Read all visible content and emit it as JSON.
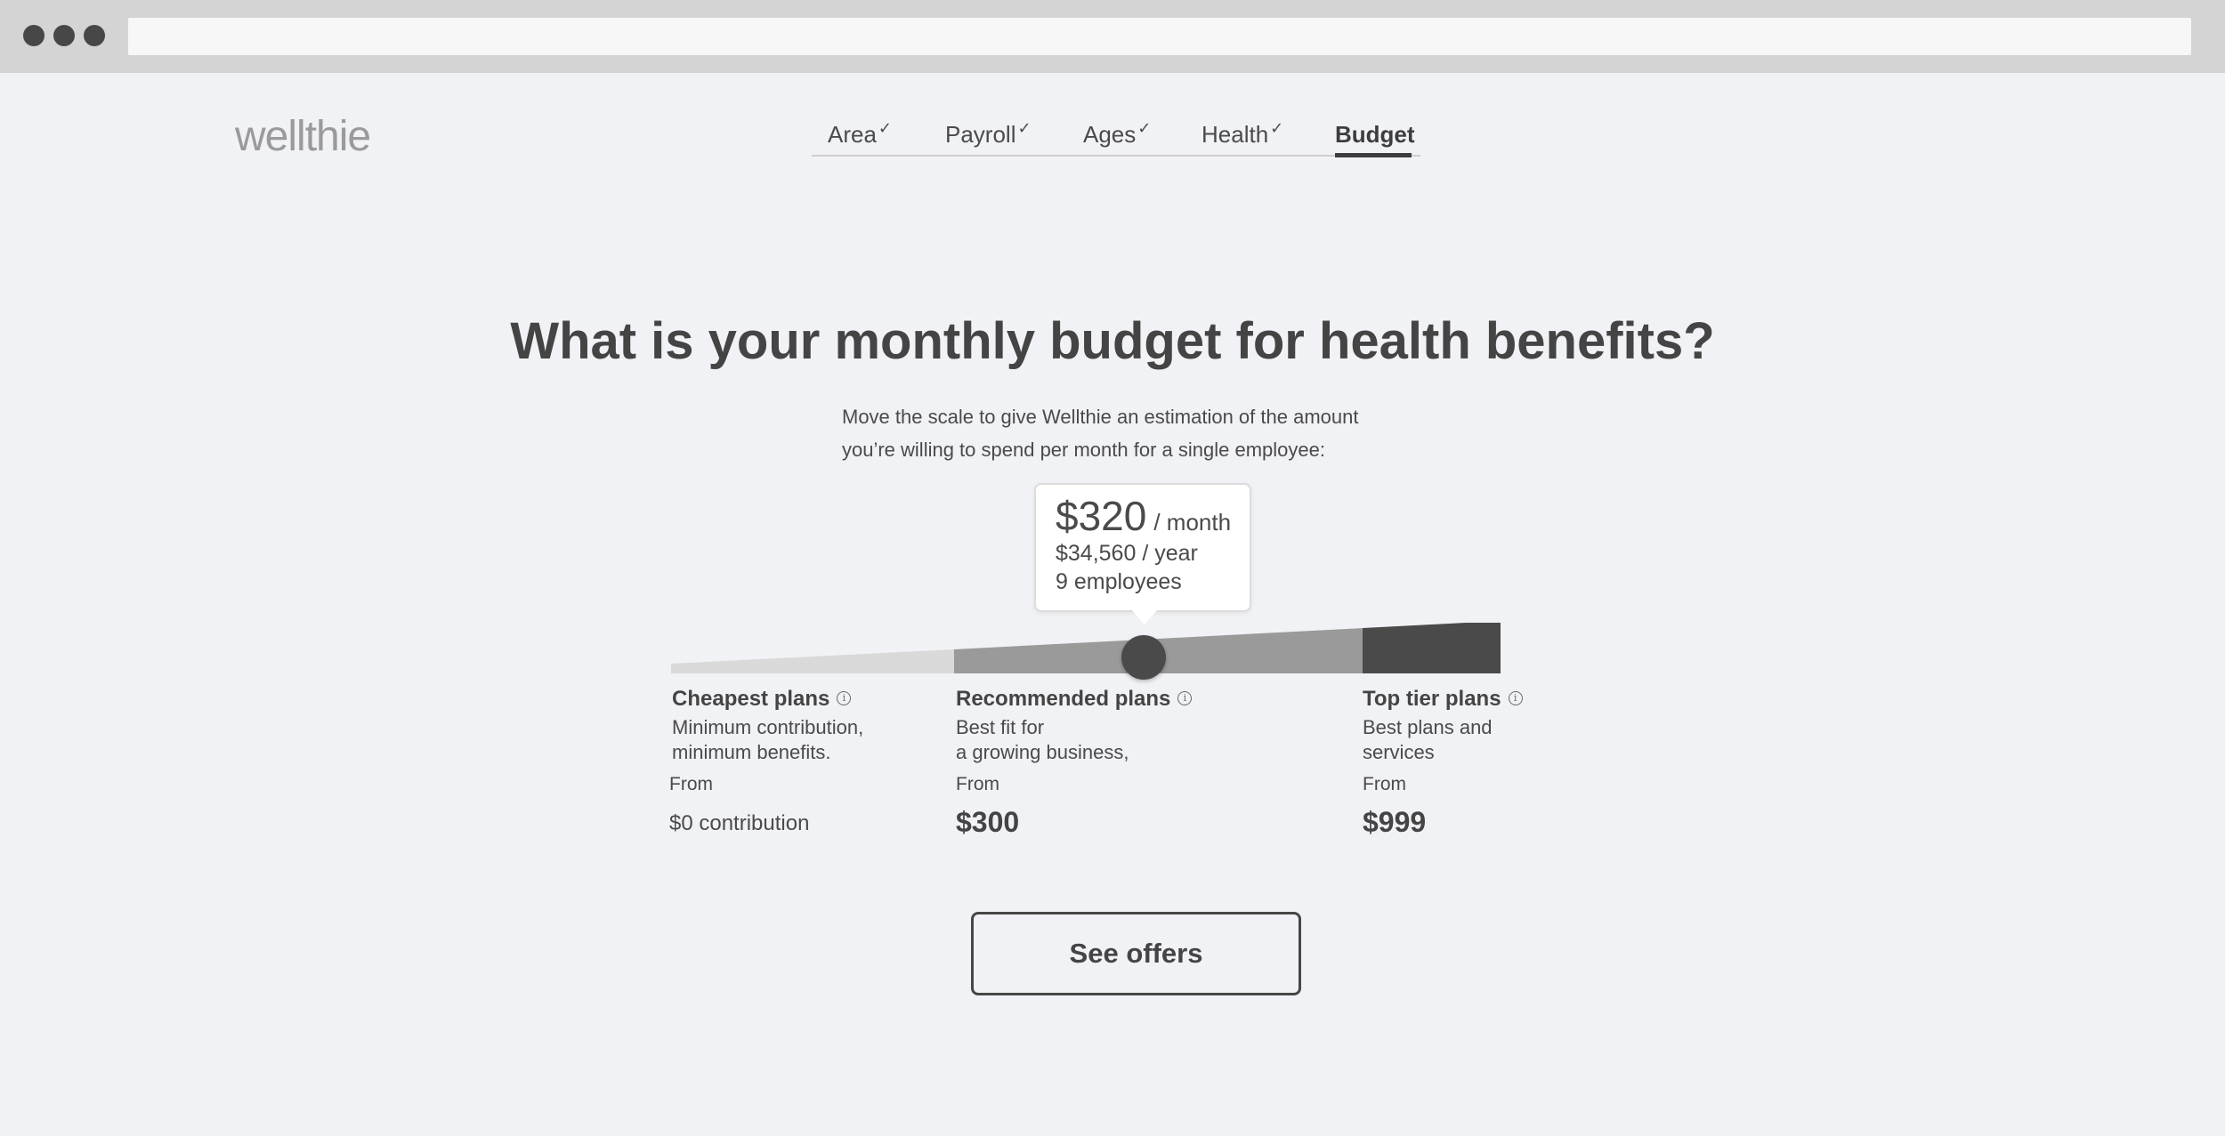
{
  "app": {
    "logo": "wellthie"
  },
  "steps": [
    {
      "label": "Area",
      "done": true
    },
    {
      "label": "Payroll",
      "done": true
    },
    {
      "label": "Ages",
      "done": true
    },
    {
      "label": "Health",
      "done": true
    },
    {
      "label": "Budget",
      "done": false,
      "active": true
    }
  ],
  "icons": {
    "check": "check-icon",
    "info": "info-icon"
  },
  "main": {
    "headline": "What is your monthly budget for health benefits?",
    "subtext_line1": "Move the scale to give Wellthie an estimation of the amount",
    "subtext_line2": "you’re willing to spend per month for a single employee:"
  },
  "estimate": {
    "monthly_amount": "$320",
    "monthly_unit": "/ month",
    "yearly": "$34,560 / year",
    "employees": "9 employees"
  },
  "slider": {
    "value": 320,
    "segment_colors": [
      "#d9d9d9",
      "#9a9a9a",
      "#4a4a4a"
    ]
  },
  "tiers": [
    {
      "title": "Cheapest plans",
      "desc_line1": "Minimum contribution,",
      "desc_line2": "minimum benefits.",
      "from_label": "From",
      "price": "$0 contribution"
    },
    {
      "title": "Recommended plans",
      "desc_line1": "Best fit for",
      "desc_line2": "a growing business,",
      "from_label": "From",
      "price": "$300"
    },
    {
      "title": "Top tier plans",
      "desc_line1": "Best plans and",
      "desc_line2": "services",
      "from_label": "From",
      "price": "$999"
    }
  ],
  "actions": {
    "see_offers": "See offers"
  }
}
